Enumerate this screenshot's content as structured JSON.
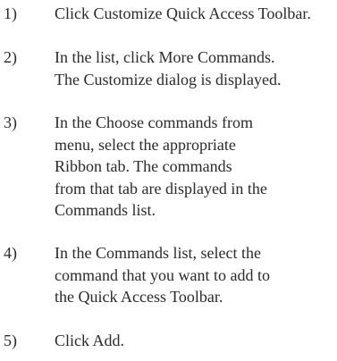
{
  "steps": [
    {
      "number": "1)",
      "lines": [
        "Click Customize Quick Access Toolbar."
      ]
    },
    {
      "number": "2)",
      "lines": [
        "In the list, click More Commands.",
        "The Customize dialog is displayed."
      ]
    },
    {
      "number": "3)",
      "lines": [
        "In the Choose commands from",
        "menu, select the appropriate",
        "Ribbon tab. The commands",
        "from that tab are displayed in the",
        "Commands list."
      ]
    },
    {
      "number": "4)",
      "lines": [
        "In the Commands list, select the",
        "command that you want to add to",
        "the Quick Access Toolbar."
      ]
    },
    {
      "number": "5)",
      "lines": [
        "Click Add."
      ]
    }
  ]
}
